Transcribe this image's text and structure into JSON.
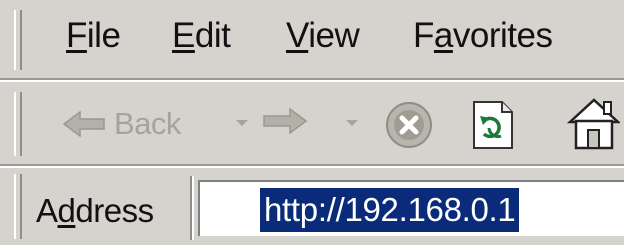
{
  "menu": {
    "items": [
      {
        "accel": "F",
        "rest": "ile"
      },
      {
        "accel": "E",
        "rest": "dit"
      },
      {
        "accel": "V",
        "rest": "iew"
      },
      {
        "pre": "F",
        "accel": "a",
        "rest": "vorites"
      }
    ]
  },
  "toolbar": {
    "back_label": "Back",
    "icons": [
      "back-arrow-icon",
      "forward-arrow-icon",
      "stop-icon",
      "refresh-icon",
      "home-icon"
    ]
  },
  "address": {
    "label_pre": "A",
    "label_accel": "d",
    "label_rest": "dress",
    "url": "http://192.168.0.1"
  },
  "colors": {
    "chrome": "#d6d3ce",
    "selection": "#0a2a7a",
    "disabled_text": "#a6a39c"
  }
}
